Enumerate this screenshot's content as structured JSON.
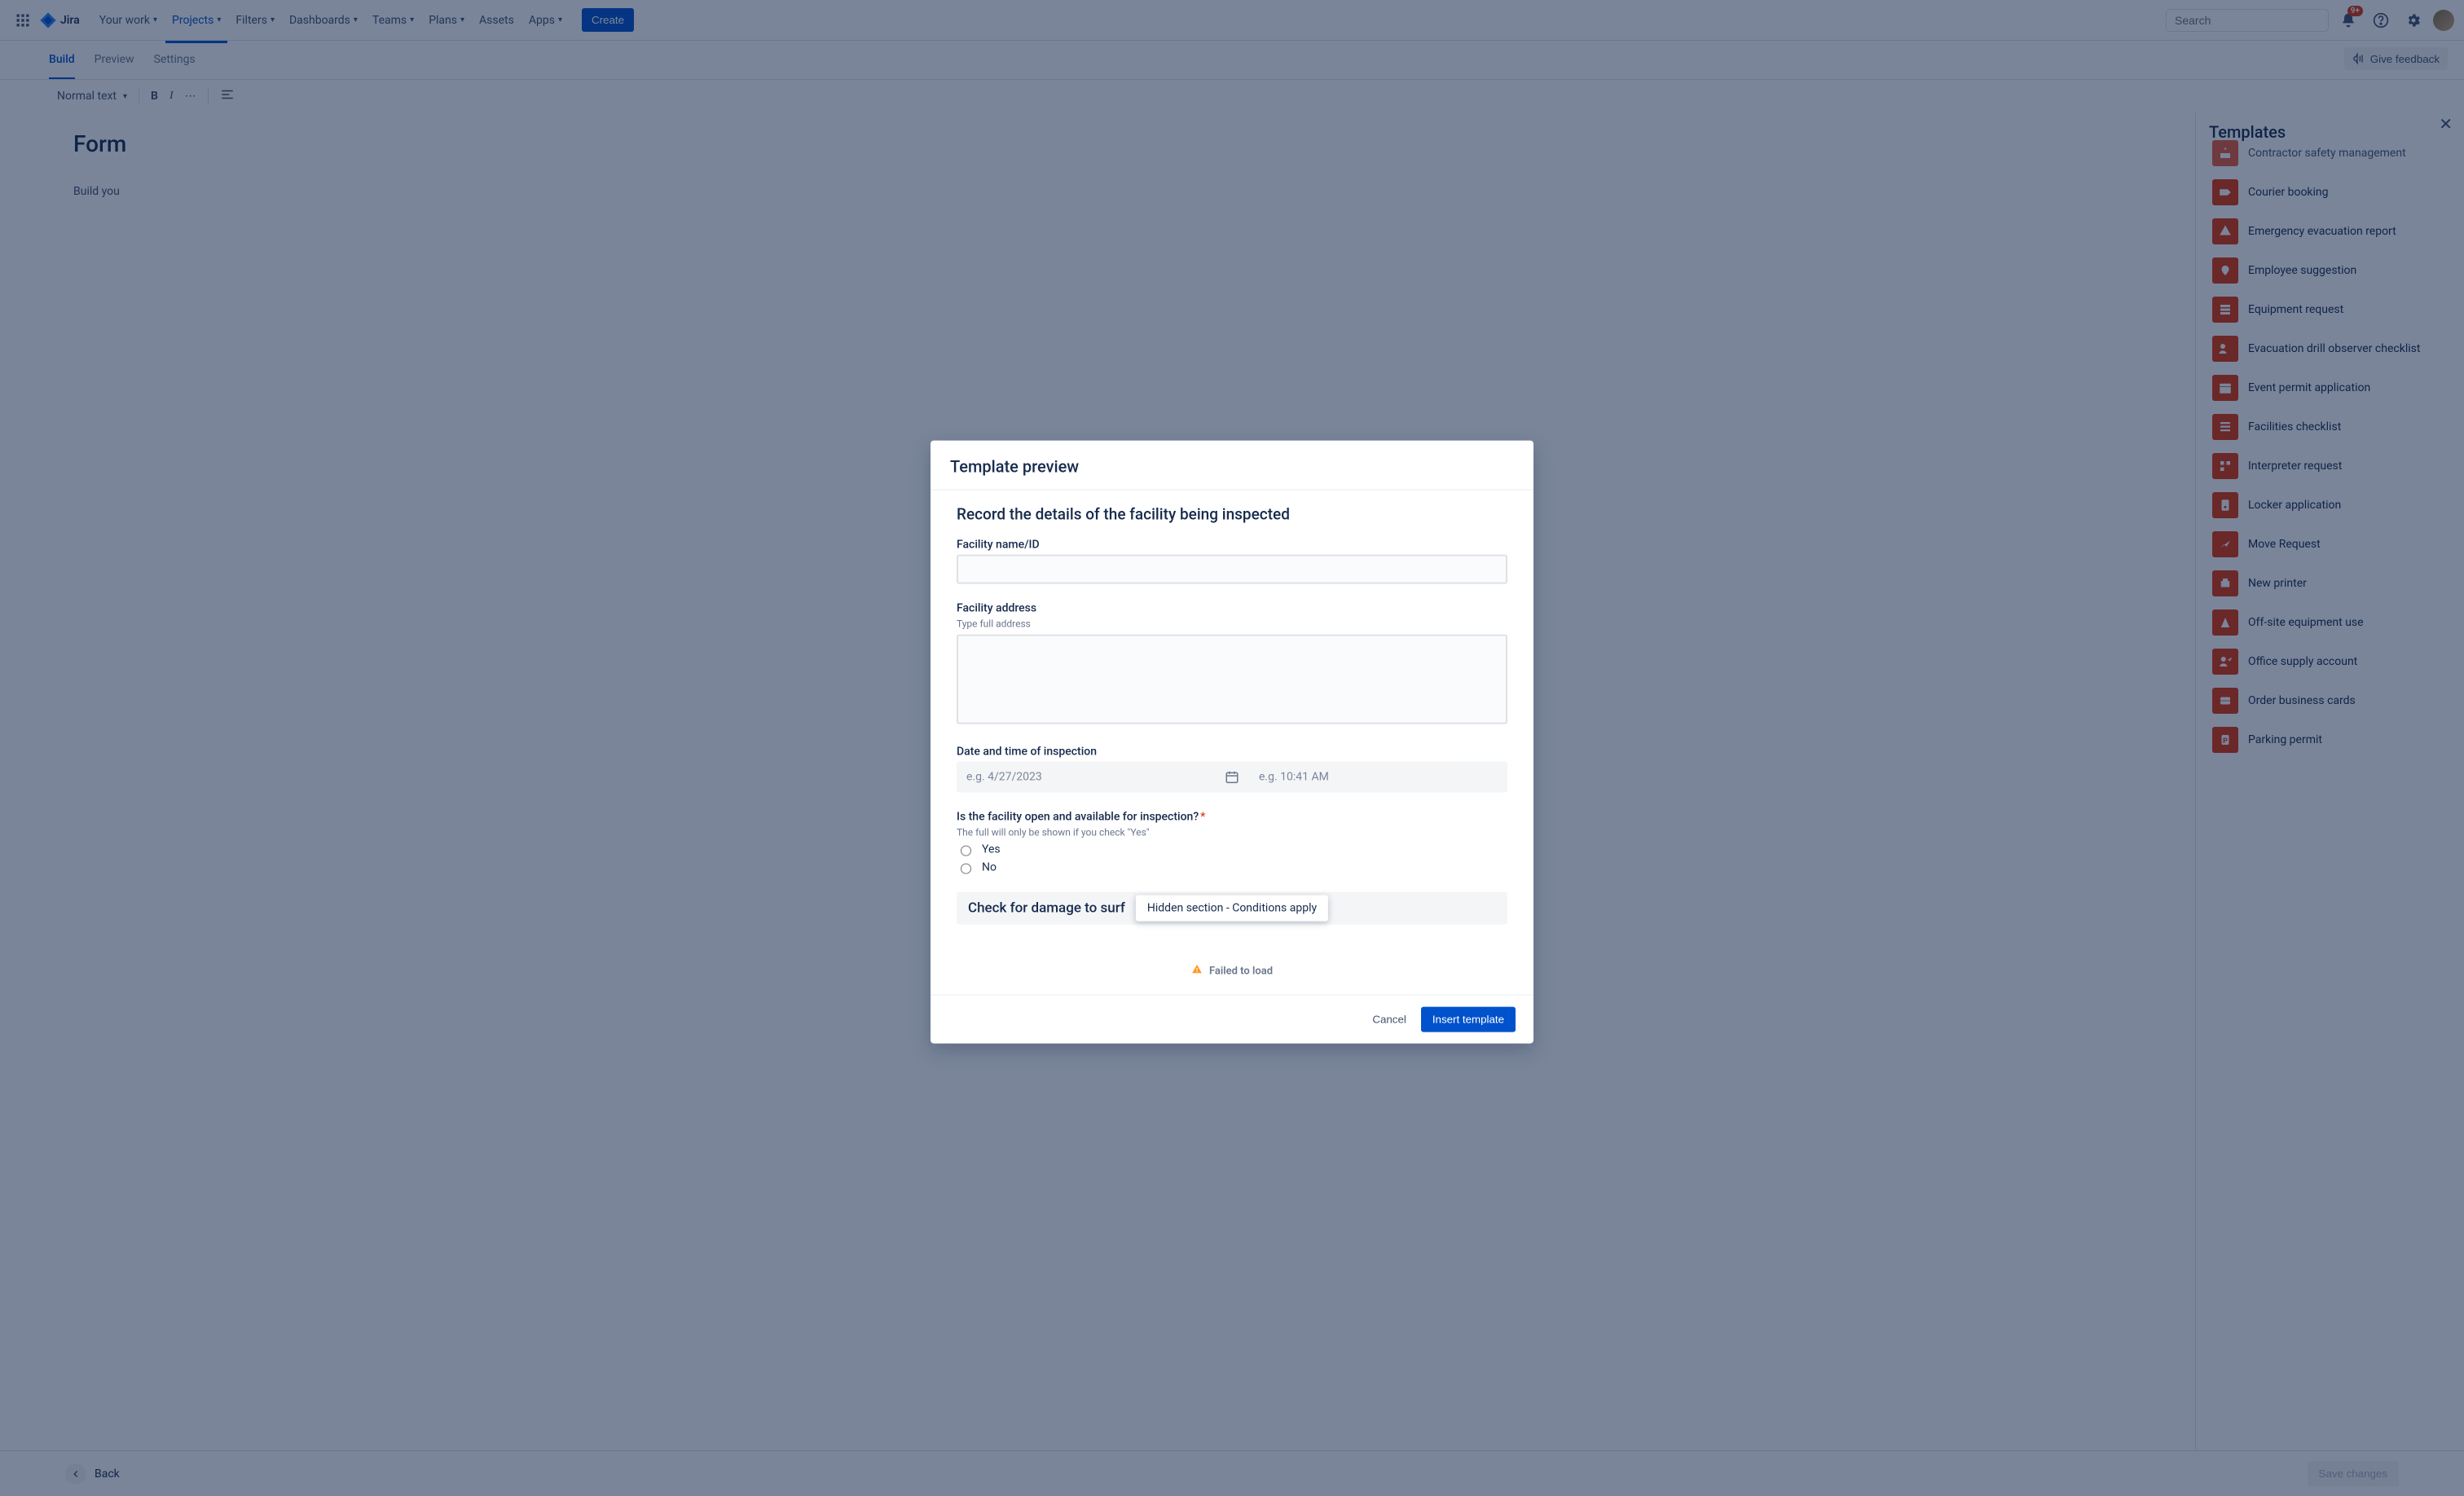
{
  "topnav": {
    "logo_text": "Jira",
    "items": [
      "Your work",
      "Projects",
      "Filters",
      "Dashboards",
      "Teams",
      "Plans",
      "Assets",
      "Apps"
    ],
    "active_index": 1,
    "items_with_chevron": [
      true,
      true,
      true,
      true,
      true,
      true,
      false,
      true
    ],
    "create_label": "Create",
    "search_placeholder": "Search",
    "notification_badge": "9+"
  },
  "subnav": {
    "tabs": [
      "Build",
      "Preview",
      "Settings"
    ],
    "active_index": 0,
    "feedback_label": "Give feedback"
  },
  "toolbar": {
    "text_style_label": "Normal text"
  },
  "doc": {
    "title": "Form",
    "hint": "Build you"
  },
  "side": {
    "heading": "Templates",
    "items": [
      "Contractor safety management",
      "Courier booking",
      "Emergency evacuation report",
      "Employee suggestion",
      "Equipment request",
      "Evacuation drill observer checklist",
      "Event permit application",
      "Facilities checklist",
      "Interpreter request",
      "Locker application",
      "Move Request",
      "New printer",
      "Off-site equipment use",
      "Office supply account",
      "Order business cards",
      "Parking permit"
    ]
  },
  "footer": {
    "back_label": "Back",
    "save_label": "Save changes"
  },
  "modal": {
    "title": "Template preview",
    "h3": "Record the details of the facility being inspected",
    "facility_name_label": "Facility name/ID",
    "facility_addr_label": "Facility address",
    "facility_addr_desc": "Type full address",
    "datetime_label": "Date and time of inspection",
    "date_placeholder": "e.g. 4/27/2023",
    "time_placeholder": "e.g. 10:41 AM",
    "open_q_label": "Is the facility open and available for inspection?",
    "open_q_desc": "The full will only be shown if you check \"Yes\"",
    "radio_yes": "Yes",
    "radio_no": "No",
    "section_text": "Check for damage to surf",
    "tooltip_text": "Hidden section - Conditions apply",
    "fail_text": "Failed to load",
    "cancel_label": "Cancel",
    "insert_label": "Insert template"
  }
}
